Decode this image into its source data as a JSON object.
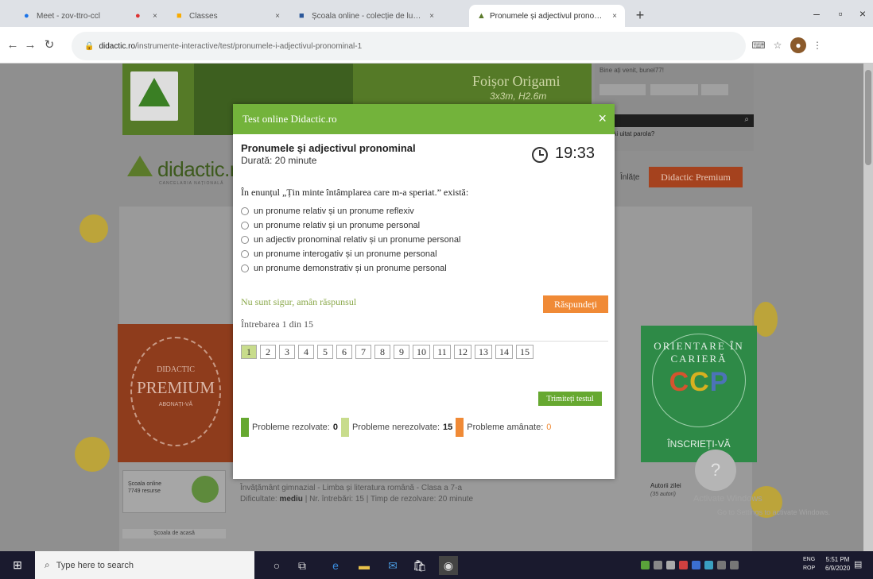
{
  "browser": {
    "tabs": [
      {
        "title": "Meet - zov-ttro-ccl",
        "close": "×"
      },
      {
        "title": "",
        "close": "×"
      },
      {
        "title": "Classes",
        "close": "×"
      },
      {
        "title": "Școala online - colecție de lucrări",
        "close": "×"
      },
      {
        "title": "Pronumele și adjectivul pronominal",
        "close": "×"
      }
    ],
    "new_tab": "+",
    "url_host": "didactic.ro",
    "url_path": "/instrumente-interactive/test/pronumele-i-adjectivul-pronominal-1"
  },
  "page": {
    "banner": {
      "title": "Foișor Origami",
      "subtitle": "3x3m, H2.6m"
    },
    "login": {
      "line": "Bine ați venit, bunel77!"
    },
    "forgot": "Ai uitat parola?",
    "brand": {
      "name": "didactic.r",
      "sub": "CANCELARIA NAȚIONALĂ"
    },
    "nav_text": "Înlățe",
    "premium_button": "Didactic Premium",
    "premium_box": {
      "line1": "DIDACTIC",
      "line2": "PREMIUM",
      "line3": "ABONAȚI-VĂ"
    },
    "ccp_box": {
      "arc": "ORIENTARE ÎN CARIERĂ",
      "c1": "C",
      "c2": "C",
      "c3": "P",
      "cta": "ÎNSCRIEȚI-VĂ"
    },
    "left_widget": {
      "title": "Școala online",
      "sub": "7749 resurse",
      "link": "Școala de acasă"
    },
    "info_line": "Învățământ gimnazial - Limba și literatura română - Clasa a 7-a",
    "info_difficulty_label": "Dificultate:",
    "info_difficulty": "mediu",
    "info_rest": " | Nr. întrebări: 15 | Timp de rezolvare: 20 minute",
    "right_widget": {
      "title": "Autorii zilei",
      "sub": "(35 autori)"
    },
    "watermark": "Activate Windows",
    "watermark2": "Go to Settings to activate Windows.",
    "avatar_q": "?"
  },
  "modal": {
    "header": "Test online Didactic.ro",
    "close": "×",
    "test_title": "Pronumele și adjectivul pronominal",
    "duration": "Durată: 20 minute",
    "timer": "19:33",
    "question": "În enunțul „Țin minte întâmplarea care m-a speriat.” există:",
    "options": [
      "un pronume relativ și un pronume reflexiv",
      "un pronume relativ și un pronume personal",
      "un adjectiv pronominal relativ și un pronume personal",
      "un pronume interogativ și un pronume personal",
      "un pronume demonstrativ și un pronume personal"
    ],
    "not_sure": "Nu sunt sigur, amân răspunsul",
    "answer_button": "Răspundeți",
    "progress": "Întrebarea 1 din 15",
    "question_numbers": [
      "1",
      "2",
      "3",
      "4",
      "5",
      "6",
      "7",
      "8",
      "9",
      "10",
      "11",
      "12",
      "13",
      "14",
      "15"
    ],
    "finish_button": "Trimiteți testul",
    "legend": {
      "solved_label": "Probleme rezolvate:",
      "solved": "0",
      "unsolved_label": "Probleme nerezolvate:",
      "unsolved": "15",
      "postponed_label": "Probleme amânate:",
      "postponed": "0"
    },
    "colors": {
      "header": "#73b33b",
      "answer": "#f08a36",
      "finish": "#66a830",
      "current": "#c8dc8c"
    }
  },
  "taskbar": {
    "search_placeholder": "Type here to search",
    "lang1": "ENG",
    "lang2": "ROP",
    "time": "5:51 PM",
    "date": "6/9/2020"
  }
}
